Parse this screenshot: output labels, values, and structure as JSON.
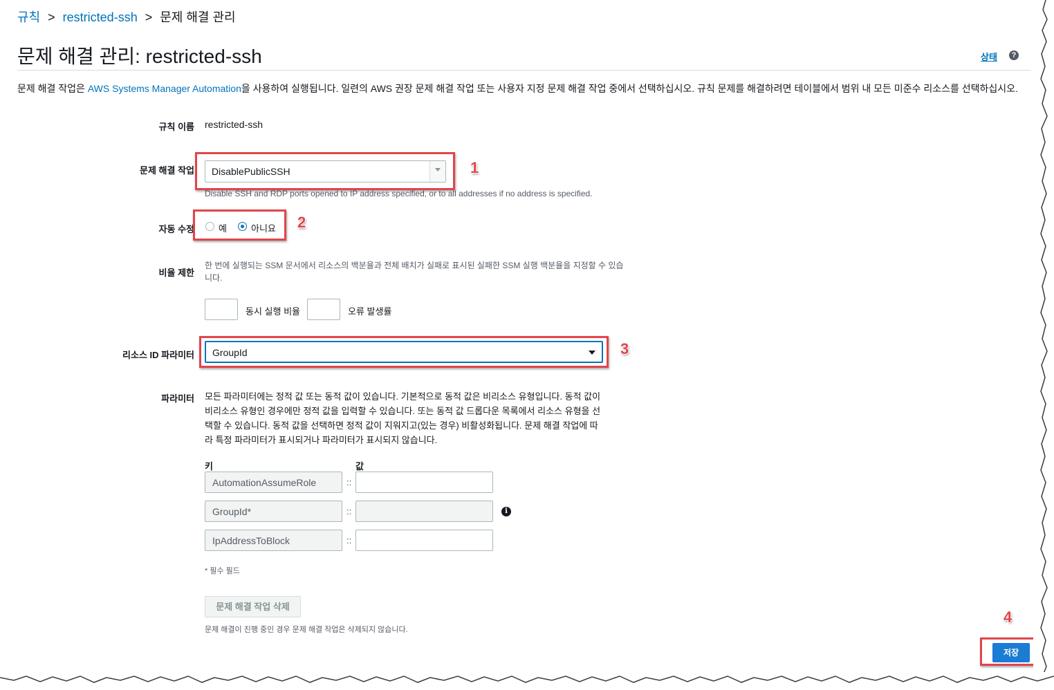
{
  "breadcrumb": {
    "root": "규칙",
    "separator": ">",
    "rule": "restricted-ssh",
    "current": "문제 해결 관리"
  },
  "header": {
    "title": "문제 해결 관리: restricted-ssh",
    "status_link": "상태",
    "help_icon": "?"
  },
  "description": {
    "before": "문제 해결 작업은 ",
    "link": "AWS Systems Manager Automation",
    "after": "을 사용하여 실행됩니다. 일련의 AWS 권장 문제 해결 작업 또는 사용자 지정 문제 해결 작업 중에서 선택하십시오. 규칙 문제를 해결하려면 테이블에서 범위 내 모든 미준수 리소스를 선택하십시오."
  },
  "form": {
    "rule_name_label": "규칙 이름",
    "rule_name_value": "restricted-ssh",
    "action_label": "문제 해결 작업",
    "action_value": "DisablePublicSSH",
    "action_hint": "Disable SSH and RDP ports opened to IP address specified, or to all addresses if no address is specified.",
    "auto_label": "자동 수정",
    "auto_yes": "예",
    "auto_no": "아니요",
    "auto_selected": "아니요",
    "rate_label": "비율 제한",
    "rate_hint_line1": "한 번에 실행되는 SSM 문서에서 리소스의 백분율과 전체 배치가 실패로 표시된 실패한 SSM 실행 백분율을 지정할 수 있습",
    "rate_hint_line2": "니다.",
    "concurrency_label": "동시 실행 비율",
    "error_label": "오류 발생률",
    "resource_id_label": "리소스 ID 파라미터",
    "resource_id_value": "GroupId",
    "params_label": "파라미터",
    "params_desc": "모든 파라미터에는 정적 값 또는 동적 값이 있습니다. 기본적으로 동적 값은 비리소스 유형입니다. 동적 값이 비리소스 유형인 경우에만 정적 값을 입력할 수 있습니다. 또는 동적 값 드롭다운 목록에서 리소스 유형을 선택할 수 있습니다. 동적 값을 선택하면 정적 값이 지워지고(있는 경우) 비활성화됩니다. 문제 해결 작업에 따라 특정 파라미터가 표시되거나 파라미터가 표시되지 않습니다.",
    "key_header": "키",
    "value_header": "값",
    "params": [
      {
        "key": "AutomationAssumeRole",
        "sep": "::",
        "value": ""
      },
      {
        "key": "GroupId*",
        "sep": "::",
        "value": ""
      },
      {
        "key": "IpAddressToBlock",
        "sep": "::",
        "value": ""
      }
    ],
    "required_note": "* 필수 필드",
    "delete_button": "문제 해결 작업 삭제",
    "delete_note": "문제 해결이 진행 중인 경우 문제 해결 작업은 삭제되지 않습니다.",
    "save_button": "저장"
  },
  "annotations": {
    "n1": "1",
    "n2": "2",
    "n3": "3",
    "n4": "4",
    "color": "#e0454b"
  },
  "icons": {
    "help": "help-circle-icon",
    "info": "info-circle-icon",
    "caret": "chevron-down-icon"
  }
}
